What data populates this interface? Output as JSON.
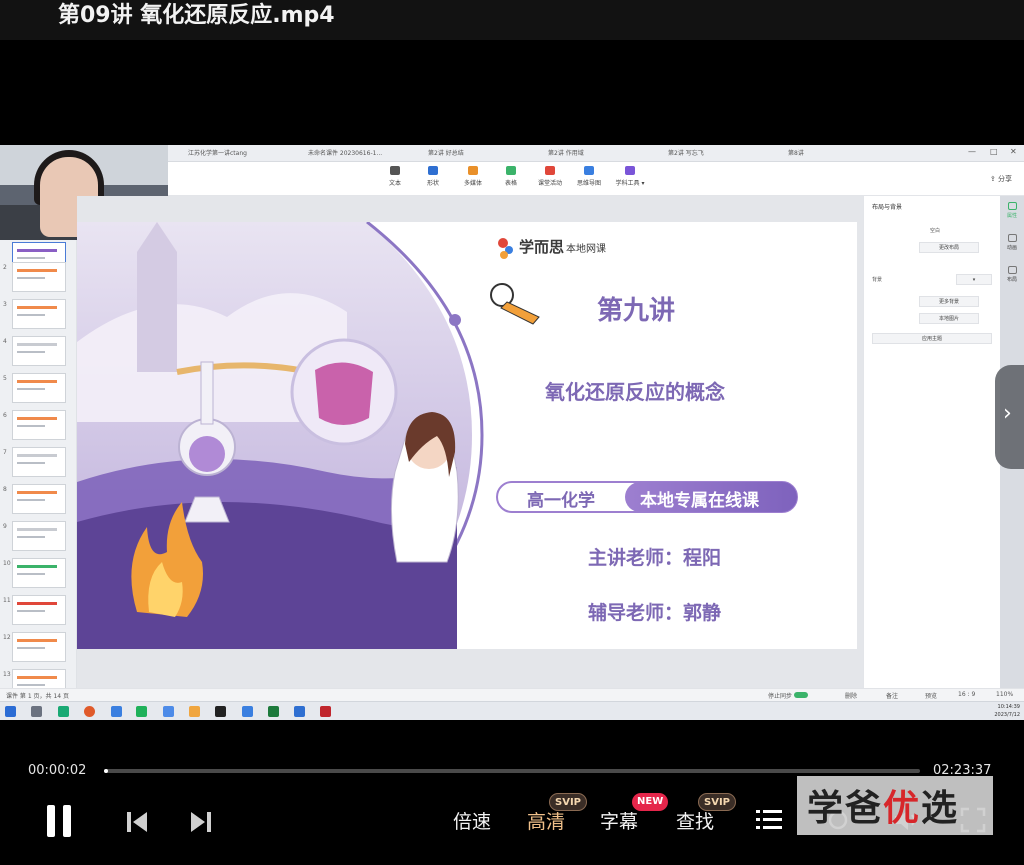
{
  "video_title": "第09讲 氧化还原反应.mp4",
  "app": {
    "tabs": [
      "江苏化学第一讲ctang",
      "未命名课件 20230616-1...",
      "第2讲 好总结",
      "第2讲 作用域",
      "第2讲 写忘飞",
      "第8讲"
    ],
    "toolbar": [
      {
        "label": "文本",
        "color": "#555555"
      },
      {
        "label": "形状",
        "color": "#2f6fd1"
      },
      {
        "label": "多媒体",
        "color": "#e9902a"
      },
      {
        "label": "表格",
        "color": "#3bb36a"
      },
      {
        "label": "课堂活动",
        "color": "#e0473a"
      },
      {
        "label": "思维导图",
        "color": "#3a7fe0"
      },
      {
        "label": "学科工具 ▾",
        "color": "#7a55d8"
      }
    ],
    "share_label": "分享",
    "thumbnail_numbers": [
      "2",
      "3",
      "4",
      "5",
      "6",
      "7",
      "8",
      "9",
      "10",
      "11",
      "12",
      "13"
    ],
    "right_panel": {
      "title": "布局与背景",
      "layout_value": "空白",
      "change_layout": "更改布局",
      "background_label": "背景",
      "more_background": "更多背景",
      "local_image": "本地图片",
      "apply_theme": "应用主题"
    },
    "side_tabs": [
      "属性",
      "动画",
      "布局"
    ],
    "status_left": "课件 第 1 页，共 14 页",
    "status_sync": "停止同步",
    "status_items": [
      "删除",
      "备注",
      "预览",
      "16 : 9",
      "110%"
    ],
    "clock_time": "10:14:39",
    "clock_date": "2023/7/12"
  },
  "slide": {
    "brand": "学而思",
    "brand_sub": "本地网课",
    "lecture": "第九讲",
    "topic": "氧化还原反应的概念",
    "course_left": "高一化学",
    "course_right": "本地专属在线课",
    "teacher": "主讲老师：程阳",
    "tutor": "辅导老师：郭静"
  },
  "player": {
    "current_time": "00:00:02",
    "total_time": "02:23:37",
    "progress": 0.0002,
    "speed_label": "倍速",
    "quality_label": "高清",
    "quality_badge": "SVIP",
    "subtitle_label": "字幕",
    "subtitle_badge": "NEW",
    "search_label": "查找",
    "search_badge": "SVIP"
  },
  "watermark": {
    "part1": "学爸",
    "part2": "优",
    "part3": "选"
  }
}
